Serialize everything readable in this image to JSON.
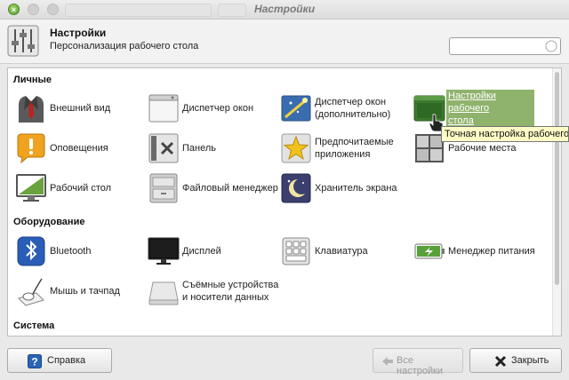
{
  "window": {
    "title": "Настройки"
  },
  "header": {
    "title": "Настройки",
    "subtitle": "Персонализация рабочего стола",
    "search_value": ""
  },
  "sections": [
    {
      "label": "Личные",
      "items": [
        {
          "label": "Внешний вид",
          "icon": "suit-tie-icon"
        },
        {
          "label": "Диспетчер окон",
          "icon": "window-icon"
        },
        {
          "label": "Диспетчер окон\n(дополнительно)",
          "icon": "window-sparkle-icon"
        },
        {
          "label": "Настройки рабочего\nстола",
          "icon": "desktop-green-icon",
          "selected": true
        },
        {
          "label": "Оповещения",
          "icon": "speech-bubble-exclamation-icon"
        },
        {
          "label": "Панель",
          "icon": "panel-icon"
        },
        {
          "label": "Предпочитаемые\nприложения",
          "icon": "star-icon"
        },
        {
          "label": "Рабочие места",
          "icon": "workspaces-grid-icon"
        },
        {
          "label": "Рабочий стол",
          "icon": "desktop-monitor-icon"
        },
        {
          "label": "Файловый менеджер",
          "icon": "file-cabinet-icon"
        },
        {
          "label": "Хранитель экрана",
          "icon": "screensaver-moon-icon"
        }
      ]
    },
    {
      "label": "Оборудование",
      "items": [
        {
          "label": "Bluetooth",
          "icon": "bluetooth-icon"
        },
        {
          "label": "Дисплей",
          "icon": "display-monitor-icon"
        },
        {
          "label": "Клавиатура",
          "icon": "keyboard-icon"
        },
        {
          "label": "Менеджер питания",
          "icon": "battery-power-icon"
        },
        {
          "label": "Мышь и тачпад",
          "icon": "mouse-touchpad-icon"
        },
        {
          "label": "Съёмные устройства\nи носители данных",
          "icon": "removable-drive-icon"
        }
      ]
    },
    {
      "label": "Система",
      "items": []
    }
  ],
  "tooltip": "Точная настройка рабочего с",
  "footer": {
    "help_label": "Справка",
    "all_settings_label": "Все настройки",
    "close_label": "Закрыть"
  },
  "colors": {
    "selection": "#8fb36d",
    "tooltip_bg": "#fffcc6",
    "close_button": "#6aad3a"
  }
}
